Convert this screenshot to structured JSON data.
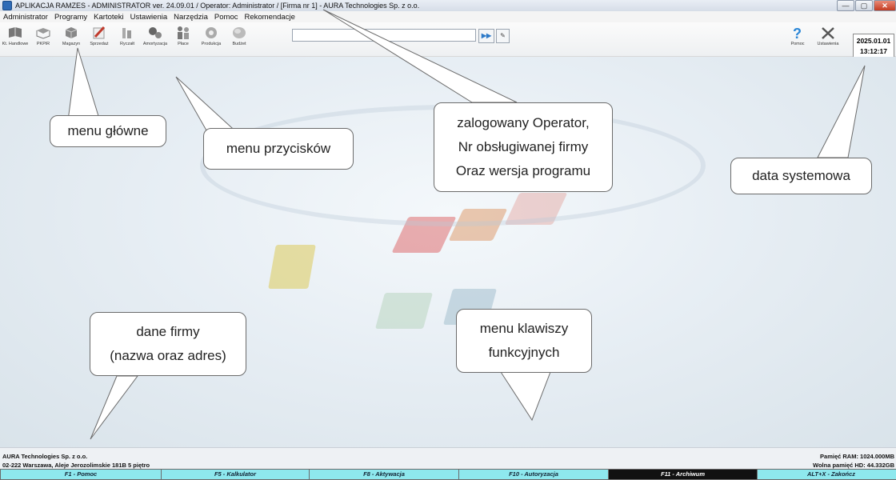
{
  "window": {
    "title": "APLIKACJA RAMZES - ADMINISTRATOR ver. 24.09.01 /  Operator: Administrator /  [Firma nr 1] - AURA Technologies Sp. z o.o.",
    "buttons": {
      "minimize": "—",
      "maximize": "▢",
      "close": "✕"
    }
  },
  "menu": [
    "Administrator",
    "Programy",
    "Kartoteki",
    "Ustawienia",
    "Narzędzia",
    "Pomoc",
    "Rekomendacje"
  ],
  "toolbar": {
    "buttons": [
      {
        "label": "Kt. Handlowe",
        "icon": "book-icon"
      },
      {
        "label": "PKPiR",
        "icon": "ledger-icon"
      },
      {
        "label": "Magazyn",
        "icon": "box-icon"
      },
      {
        "label": "Sprzedaż",
        "icon": "pen-icon"
      },
      {
        "label": "Ryczałt",
        "icon": "columns-icon"
      },
      {
        "label": "Amortyzacja",
        "icon": "gears-icon"
      },
      {
        "label": "Płace",
        "icon": "people-icon"
      },
      {
        "label": "Produkcja",
        "icon": "cog-icon"
      },
      {
        "label": "Budżet",
        "icon": "oval-icon"
      }
    ],
    "search_value": "",
    "go_label": "▶▶",
    "options_label": "✎",
    "help_label": "Pomoc",
    "settings_label": "Ustawienia",
    "date": "2025.01.01",
    "time": "13:12:17"
  },
  "callouts": {
    "main_menu": "menu główne",
    "buttons_menu": "menu przycisków",
    "operator_line1": "zalogowany Operator,",
    "operator_line2": "Nr obsługiwanej firmy",
    "operator_line3": "Oraz wersja programu",
    "system_date": "data systemowa",
    "company_line1": "dane firmy",
    "company_line2": "(nazwa oraz adres)",
    "fkeys_line1": "menu klawiszy",
    "fkeys_line2": "funkcyjnych"
  },
  "status": {
    "company_name": "AURA Technologies Sp. z o.o.",
    "company_address": "02-222 Warszawa, Aleje Jerozolimskie 181B 5 piętro",
    "ram": "Pamięć RAM: 1024.000MB",
    "hd": "Wolna pamięć HD: 44.332GB"
  },
  "fkeys": [
    {
      "label": "F1 - Pomoc",
      "dark": false
    },
    {
      "label": "F5 - Kalkulator",
      "dark": false
    },
    {
      "label": "F8 - Aktywacja",
      "dark": false
    },
    {
      "label": "F10 - Autoryzacja",
      "dark": false
    },
    {
      "label": "F11 - Archiwum",
      "dark": true
    },
    {
      "label": "ALT+X - Zakończ",
      "dark": false
    }
  ],
  "colors": {
    "fkey_bg": "#8ee8ee",
    "fkey_active_bg": "#111111",
    "title_icon": "#2f6bb6"
  }
}
